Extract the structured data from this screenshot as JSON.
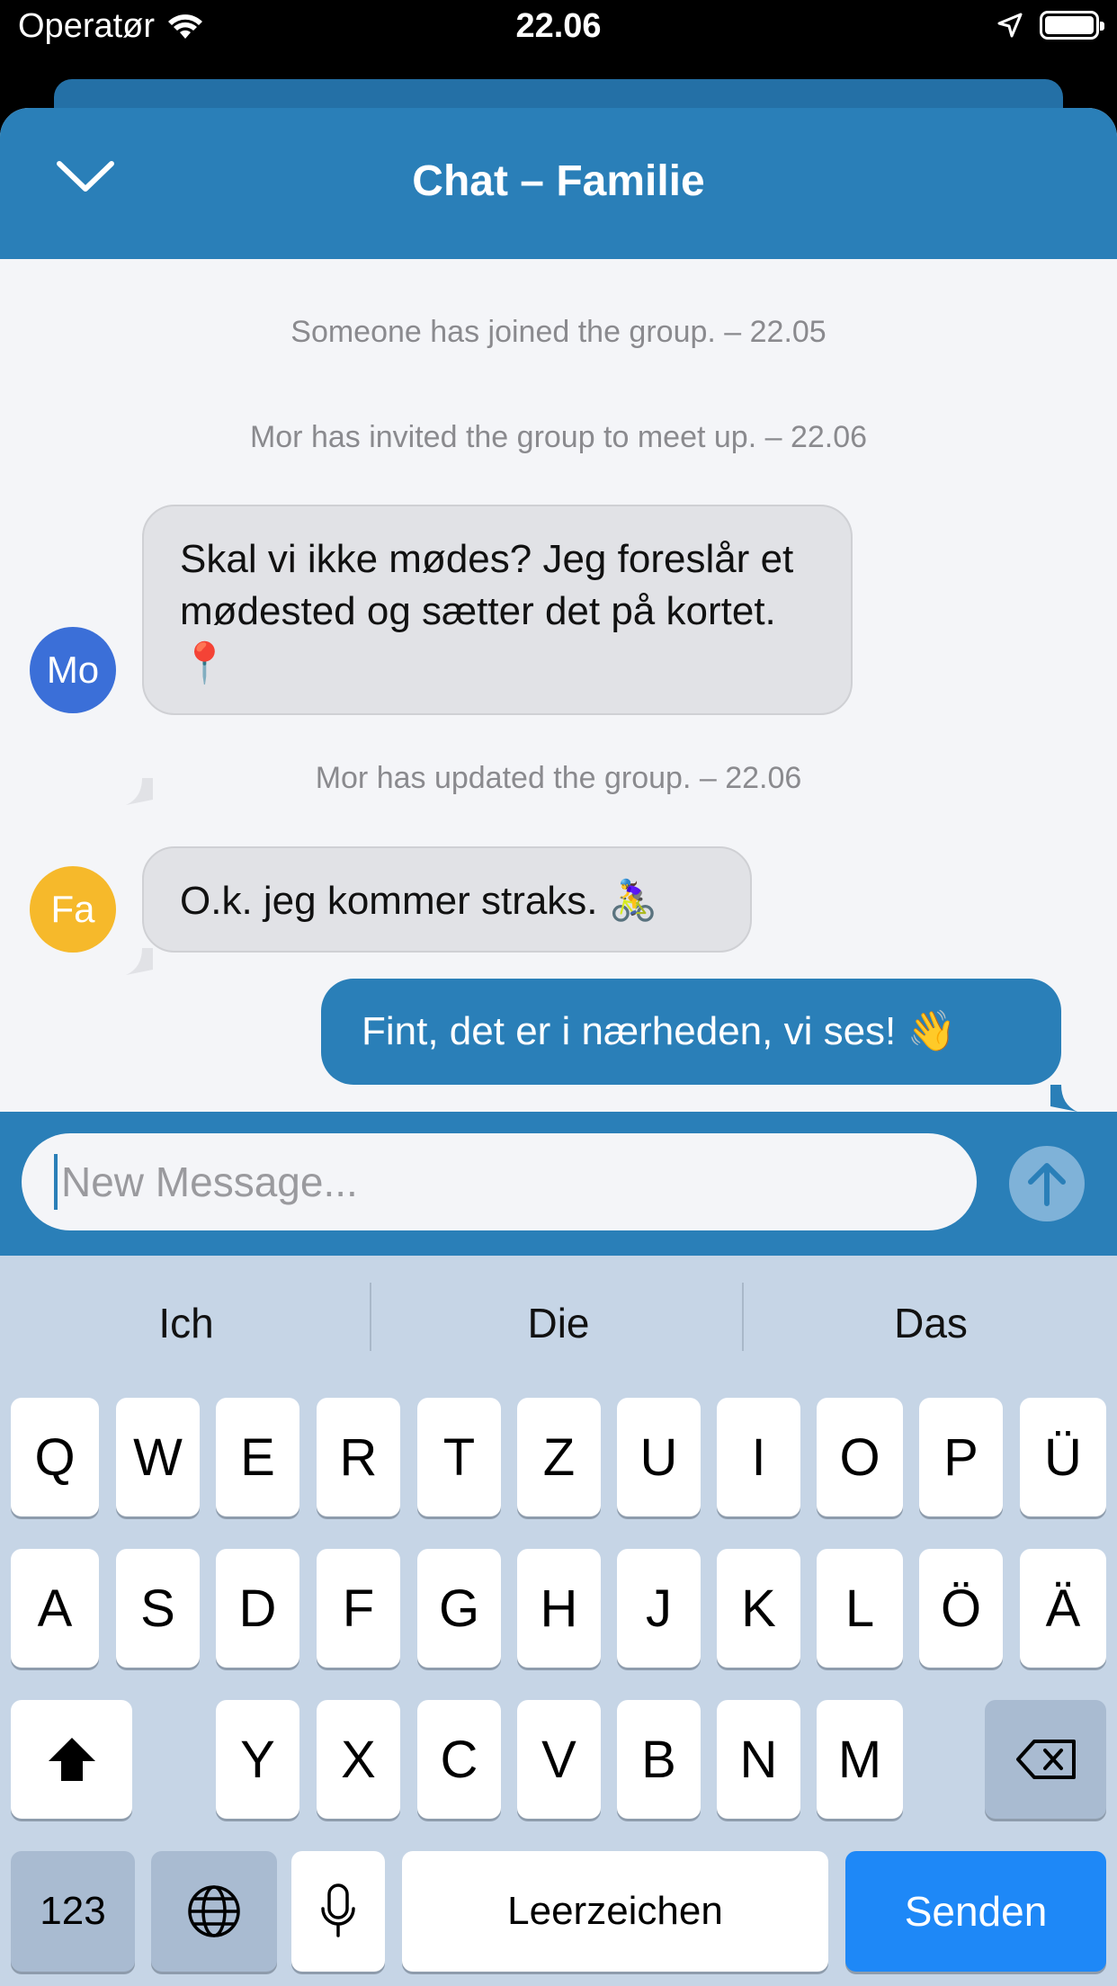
{
  "status_bar": {
    "carrier": "Operatør",
    "time": "22.06",
    "battery_level": 1.0
  },
  "nav": {
    "title": "Chat – Familie",
    "collapse_icon": "chevron-down-icon"
  },
  "messages": {
    "system_1": "Someone has joined the group. – 22.05",
    "system_2": "Mor has invited the group to meet up. – 22.06",
    "mor_avatar": "Mo",
    "mor_text": "Skal vi ikke mødes? Jeg foreslår et mødested og sætter det på kortet. 📍",
    "system_3": "Mor has updated the group. – 22.06",
    "fa_avatar": "Fa",
    "fa_text": "O.k. jeg kommer straks. 🚴‍♀️",
    "own_text": "Fint, det er i nærheden, vi ses! 👋"
  },
  "composer": {
    "placeholder": "New Message...",
    "send_icon": "arrow-up-icon"
  },
  "keyboard": {
    "suggestions": [
      "Ich",
      "Die",
      "Das"
    ],
    "row1": [
      "Q",
      "W",
      "E",
      "R",
      "T",
      "Z",
      "U",
      "I",
      "O",
      "P",
      "Ü"
    ],
    "row2": [
      "A",
      "S",
      "D",
      "F",
      "G",
      "H",
      "J",
      "K",
      "L",
      "Ö",
      "Ä"
    ],
    "row3": [
      "Y",
      "X",
      "C",
      "V",
      "B",
      "N",
      "M"
    ],
    "numbers_key": "123",
    "space_key": "Leerzeichen",
    "return_key": "Senden",
    "shift_icon": "shift-icon",
    "delete_icon": "backspace-icon",
    "globe_icon": "globe-icon",
    "mic_icon": "microphone-icon"
  },
  "colors": {
    "brand_blue": "#2a7fb8",
    "mor_avatar": "#3b6fd8",
    "fa_avatar": "#f6b92b",
    "return_key": "#1e88f7"
  }
}
